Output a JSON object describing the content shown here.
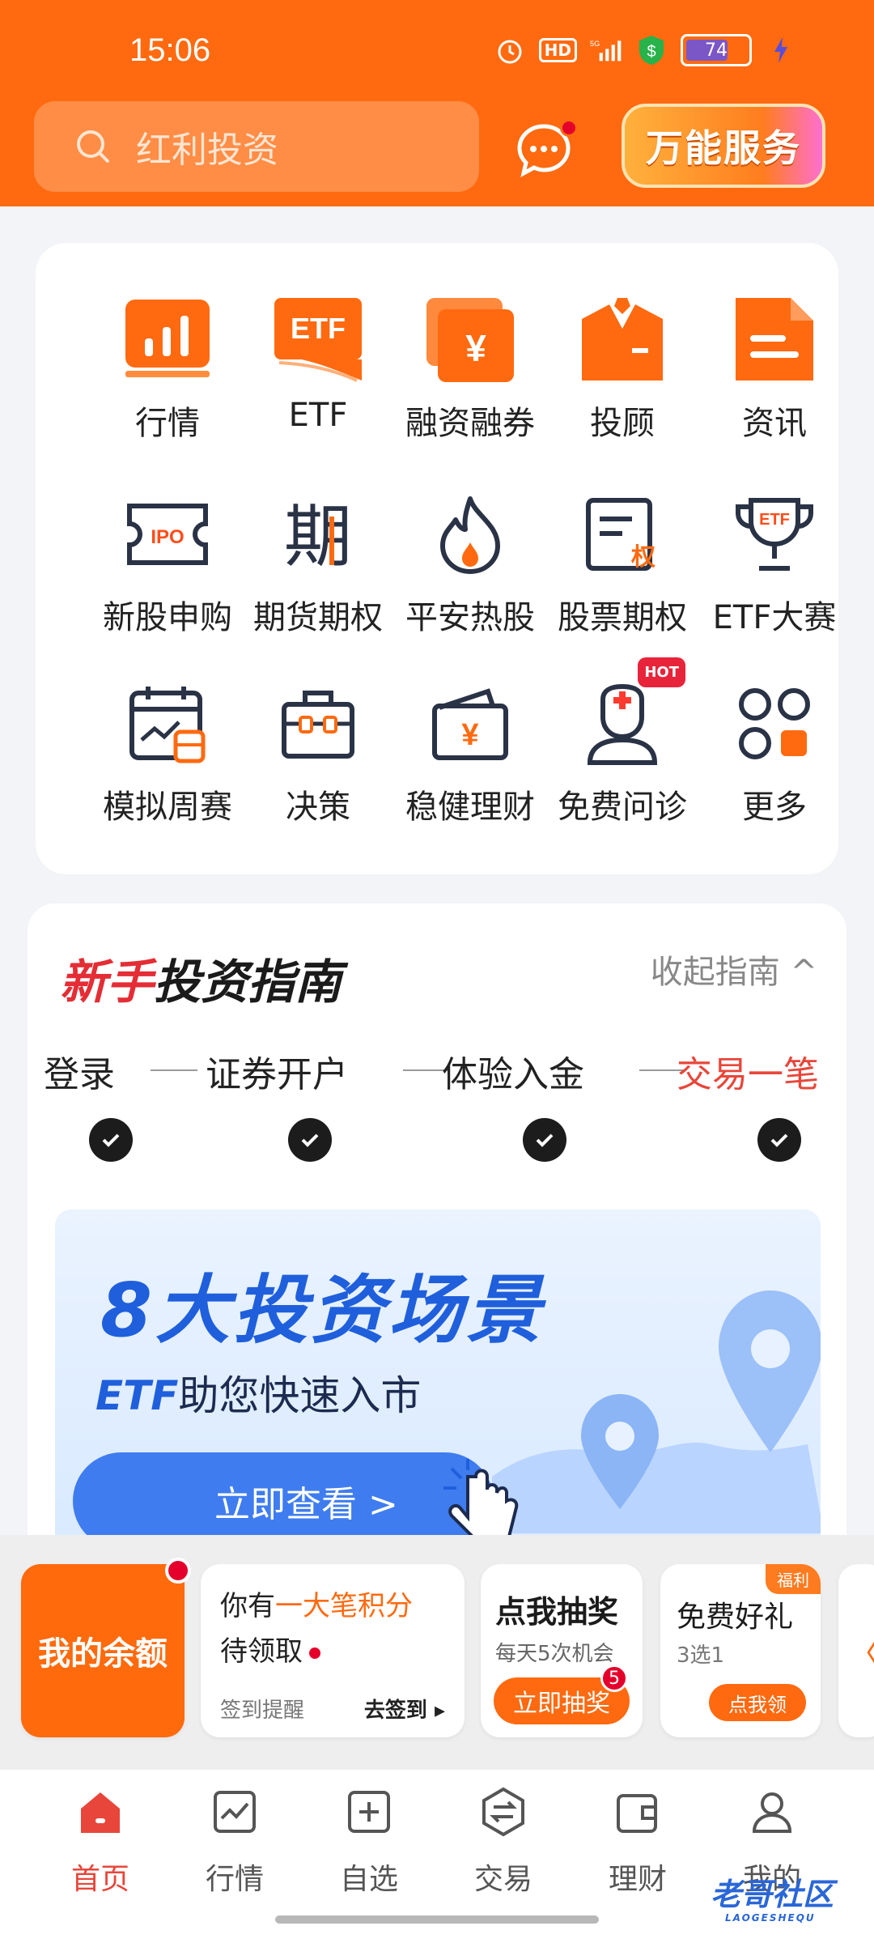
{
  "status_bar": {
    "time": "15:06",
    "hd": "HD",
    "network": "5G",
    "battery": "74"
  },
  "header": {
    "search_placeholder": "红利投资",
    "service_button": "万能服务"
  },
  "grid": [
    {
      "label": "行情"
    },
    {
      "label": "ETF"
    },
    {
      "label": "融资融券"
    },
    {
      "label": "投顾"
    },
    {
      "label": "资讯"
    },
    {
      "label": "新股申购"
    },
    {
      "label": "期货期权"
    },
    {
      "label": "平安热股"
    },
    {
      "label": "股票期权"
    },
    {
      "label": "ETF大赛"
    },
    {
      "label": "模拟周赛"
    },
    {
      "label": "决策"
    },
    {
      "label": "稳健理财"
    },
    {
      "label": "免费问诊",
      "badge": "HOT"
    },
    {
      "label": "更多"
    }
  ],
  "icon_text": {
    "etf": "ETF",
    "ipo": "IPO",
    "qi": "期",
    "quan": "权",
    "yen": "¥"
  },
  "guide": {
    "title_a": "新手",
    "title_b": "投资指南",
    "collapse": "收起指南 ^",
    "steps": [
      "登录",
      "证券开户",
      "体验入金",
      "交易一笔"
    ],
    "banner_title": "8大投资场景",
    "banner_sub_a": "ETF",
    "banner_sub_b": "助您快速入市",
    "banner_cta": "立即查看 >"
  },
  "promos": {
    "balance": "我的余额",
    "points_l1_a": "你有",
    "points_l1_b": "一大笔积分",
    "points_l2": "待领取",
    "points_hint": "签到提醒",
    "points_action": "去签到 ▸",
    "lottery_title": "点我抽奖",
    "lottery_sub": "每天5次机会",
    "lottery_btn": "立即抽奖",
    "lottery_count": "5",
    "gift_title": "免费好礼",
    "gift_sub": "3选1",
    "gift_tag": "福利",
    "gift_btn": "点我领",
    "more_arrow": "〈"
  },
  "nav": [
    {
      "label": "首页",
      "active": true
    },
    {
      "label": "行情"
    },
    {
      "label": "自选"
    },
    {
      "label": "交易"
    },
    {
      "label": "理财"
    },
    {
      "label": "我的"
    }
  ],
  "watermark": {
    "text": "老哥社区",
    "small": "LAOGESHEQU"
  },
  "colors": {
    "brand": "#ff6a10",
    "accent_red": "#e8463a",
    "banner_blue": "#3f7cef"
  }
}
